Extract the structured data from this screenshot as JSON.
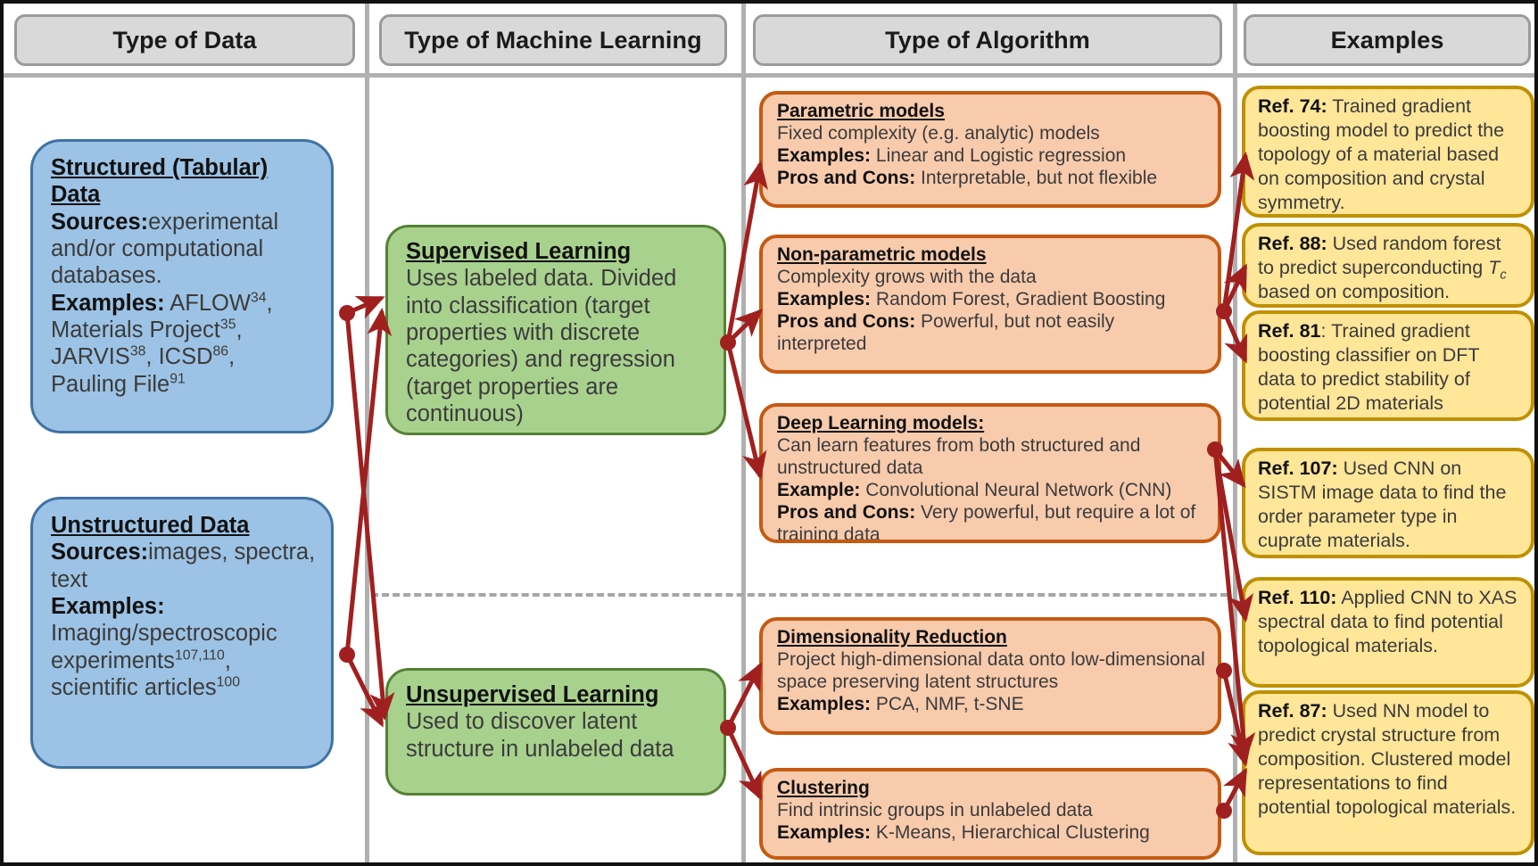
{
  "columns": [
    {
      "id": "type-of-data",
      "label": "Type of Data"
    },
    {
      "id": "type-of-machine-learning",
      "label": "Type of Machine Learning"
    },
    {
      "id": "type-of-algorithm",
      "label": "Type of Algorithm"
    },
    {
      "id": "examples",
      "label": "Examples"
    }
  ],
  "colors": {
    "data_fill": "#9cc3e5",
    "data_border": "#3f72a4",
    "ml_fill": "#a9d18e",
    "ml_border": "#548235",
    "algorithm_fill": "#f8cbad",
    "algorithm_border": "#c55a11",
    "example_fill": "#ffe699",
    "example_border": "#bf9000",
    "header_fill": "#d9d9d9",
    "header_border": "#9a9a9a",
    "arrow": "#a02020",
    "divider": "#a6a6a6"
  },
  "data_nodes": [
    {
      "id": "structured-data",
      "title": "Structured (Tabular) Data",
      "lines": [
        {
          "label": "Sources:",
          "text": " experimental and/or computational databases."
        },
        {
          "label": "Examples:",
          "text": " AFLOW34, Materials Project35, JARVIS38, ICSD86, Pauling File91"
        }
      ],
      "sources_label": "Sources:",
      "sources_text": "experimental and/or computational databases.",
      "examples_label": "Examples:",
      "examples_text": "AFLOW34, Materials Project35, JARVIS38, ICSD86, Pauling File91",
      "citations": [
        "34",
        "35",
        "38",
        "86",
        "91"
      ]
    },
    {
      "id": "unstructured-data",
      "title": "Unstructured Data",
      "sources_label": "Sources:",
      "sources_text": "images, spectra, text",
      "examples_label": "Examples:",
      "examples_text": "Imaging/spectroscopic experiments107,110, scientific articles100",
      "citations": [
        "107,110",
        "100"
      ]
    }
  ],
  "ml_nodes": [
    {
      "id": "supervised-learning",
      "title": "Supervised Learning",
      "body": "Uses labeled data. Divided into classification (target properties with discrete categories) and regression (target properties are continuous)"
    },
    {
      "id": "unsupervised-learning",
      "title": "Unsupervised Learning",
      "body": "Used to discover latent structure in unlabeled data"
    }
  ],
  "algorithm_nodes": [
    {
      "id": "parametric-models",
      "title": "Parametric models",
      "desc": "Fixed complexity (e.g. analytic) models",
      "examples_label": "Examples:",
      "examples_text": "Linear and Logistic regression",
      "proscons_label": "Pros and Cons:",
      "proscons_text": "Interpretable, but not flexible"
    },
    {
      "id": "non-parametric-models",
      "title": "Non-parametric  models",
      "desc": "Complexity grows with the data",
      "examples_label": "Examples:",
      "examples_text": "Random Forest, Gradient Boosting",
      "proscons_label": "Pros and Cons:",
      "proscons_text": "Powerful, but not easily interpreted"
    },
    {
      "id": "deep-learning-models",
      "title": "Deep Learning models:",
      "desc": "Can learn features from both structured and unstructured data",
      "examples_label": "Example:",
      "examples_text": "Convolutional Neural Network (CNN)",
      "proscons_label": "Pros and Cons:",
      "proscons_text": "Very powerful, but require a lot of training data"
    },
    {
      "id": "dimensionality-reduction",
      "title": "Dimensionality  Reduction",
      "desc": "Project high-dimensional data onto low-dimensional space preserving latent structures",
      "examples_label": "Examples:",
      "examples_text": "PCA, NMF, t-SNE",
      "proscons_label": "",
      "proscons_text": ""
    },
    {
      "id": "clustering",
      "title": "Clustering",
      "desc": "Find intrinsic groups in unlabeled data",
      "examples_label": "Examples:",
      "examples_text": "K-Means, Hierarchical Clustering",
      "proscons_label": "",
      "proscons_text": ""
    }
  ],
  "example_nodes": [
    {
      "id": "ref-74",
      "ref": "Ref. 74:",
      "text": "Trained gradient boosting model to predict the topology of a material based on composition and crystal symmetry."
    },
    {
      "id": "ref-88",
      "ref": "Ref. 88:",
      "text_before": "Used random forest to predict superconducting ",
      "symbol": "Tc",
      "text_after": " based on composition."
    },
    {
      "id": "ref-81",
      "ref": "Ref. 81",
      "text": ": Trained gradient boosting classifier on DFT data to predict stability of potential 2D materials"
    },
    {
      "id": "ref-107",
      "ref": "Ref. 107:",
      "text": "Used CNN on SISTM image data to find the order parameter type in cuprate materials."
    },
    {
      "id": "ref-110",
      "ref": "Ref. 110:",
      "text": "Applied CNN to XAS spectral data to find potential topological materials."
    },
    {
      "id": "ref-87",
      "ref": "Ref. 87:",
      "text": "Used NN model to predict crystal structure from composition. Clustered model representations to find potential topological materials."
    }
  ]
}
